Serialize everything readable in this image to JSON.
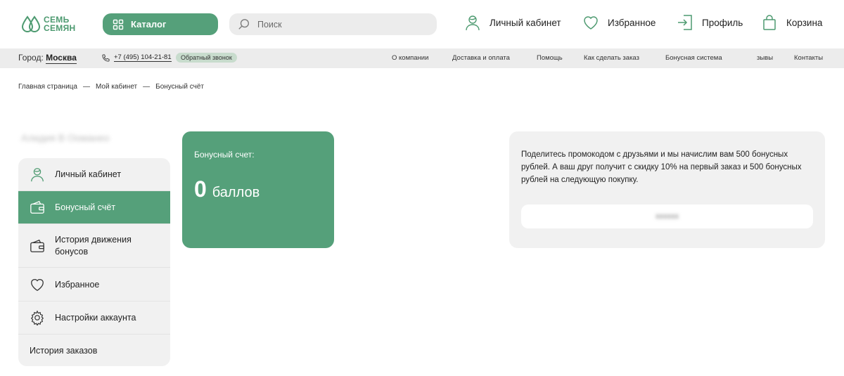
{
  "header": {
    "logo_line1": "СЕМЬ",
    "logo_line2": "СЕМЯН",
    "catalog_label": "Каталог",
    "search_placeholder": "Поиск",
    "account_label": "Личный кабинет",
    "favorites_label": "Избранное",
    "profile_label": "Профиль",
    "cart_label": "Корзина"
  },
  "infobar": {
    "city_label": "Город:",
    "city_value": "Москва",
    "phone": "+7 (495) 104-21-81",
    "callback_label": "Обратный звонок",
    "nav": [
      "О компании",
      "Доставка и оплата",
      "Помощь",
      "Как сделать заказ",
      "Бонусная система",
      "зывы",
      "Контакты"
    ]
  },
  "breadcrumb": [
    "Главная страница",
    "Мой кабинет",
    "Бонусный счёт"
  ],
  "breadcrumb_sep": "—",
  "user": {
    "name": "Алидия В Ооманео"
  },
  "sidebar": {
    "items": [
      {
        "label": "Личный кабинет",
        "icon": "user-icon"
      },
      {
        "label": "Бонусный счёт",
        "icon": "wallet-icon",
        "active": true
      },
      {
        "label": "История движения бонусов",
        "icon": "wallet-icon"
      },
      {
        "label": "Избранное",
        "icon": "heart-icon"
      },
      {
        "label": "Настройки аккаунта",
        "icon": "gear-icon"
      },
      {
        "label": "История заказов",
        "icon": ""
      }
    ]
  },
  "bonus": {
    "label": "Бонусный счет:",
    "value": "0",
    "unit": "баллов"
  },
  "promo": {
    "text": "Поделитесь промокодом с друзьями и мы начислим вам 500 бонусных рублей. А ваш друг получит с скидку 10% на первый заказ и 500 бонусных рублей на следующую покупку.",
    "code": "хххххх"
  },
  "colors": {
    "accent": "#55a07a",
    "panel": "#f1f1f1",
    "infobar": "#ececec"
  }
}
